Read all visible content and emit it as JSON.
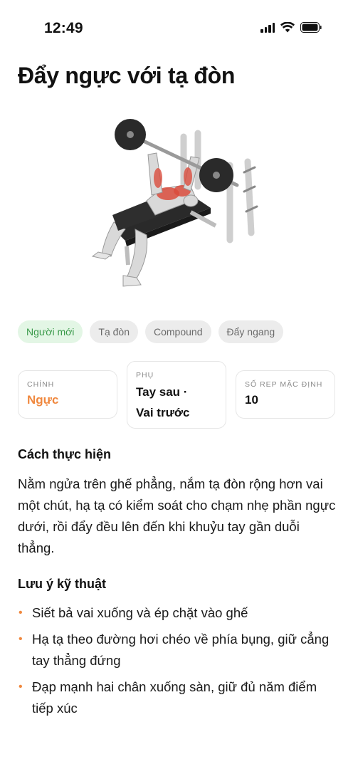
{
  "status_bar": {
    "time": "12:49"
  },
  "title": "Đẩy ngực với tạ đòn",
  "tags": [
    "Người mới",
    "Tạ đòn",
    "Compound",
    "Đẩy ngang"
  ],
  "stats": {
    "primary": {
      "label": "CHÍNH",
      "value": "Ngực"
    },
    "secondary": {
      "label": "PHỤ",
      "value_line1": "Tay sau ·",
      "value_line2": "Vai trước"
    },
    "reps": {
      "label": "SỐ REP MẶC ĐỊNH",
      "value": "10"
    }
  },
  "instructions": {
    "title": "Cách thực hiện",
    "text": "Nằm ngửa trên ghế phẳng, nắm tạ đòn rộng hơn vai một chút, hạ tạ có kiểm soát cho chạm nhẹ phần ngực dưới, rồi đẩy đều lên đến khi khuỷu tay gần duỗi thẳng."
  },
  "technique": {
    "title": "Lưu ý kỹ thuật",
    "tips": [
      "Siết bả vai xuống và ép chặt vào ghế",
      "Hạ tạ theo đường hơi chéo về phía bụng, giữ cẳng tay thẳng đứng",
      "Đạp mạnh hai chân xuống sàn, giữ đủ năm điểm tiếp xúc"
    ]
  },
  "colors": {
    "accent_orange": "#f0883e",
    "tag_green_bg": "#e3f6e5",
    "tag_green_text": "#3a9a4a"
  },
  "icons": [
    "signal-icon",
    "wifi-icon",
    "battery-icon",
    "bench-press-illustration"
  ]
}
